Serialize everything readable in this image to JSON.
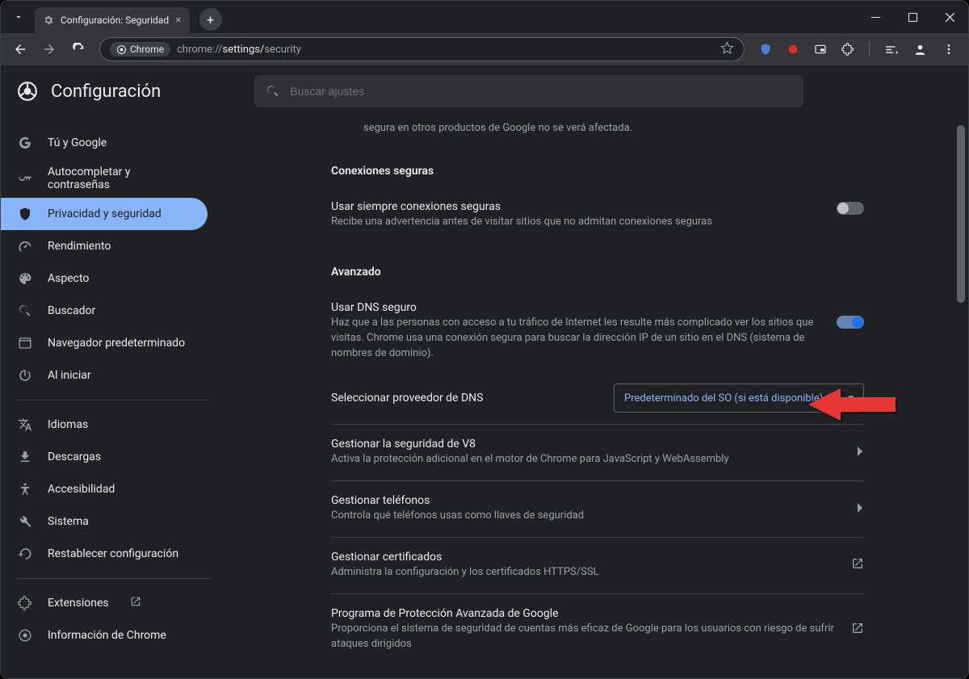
{
  "browser": {
    "tab_title": "Configuración: Seguridad",
    "omnibox_chip": "Chrome",
    "url_scheme": "chrome://",
    "url_path1": "settings/",
    "url_path2": "security"
  },
  "app": {
    "title": "Configuración",
    "search_placeholder": "Buscar ajustes"
  },
  "sidebar": {
    "items": [
      {
        "label": "Tú y Google"
      },
      {
        "label": "Autocompletar y contraseñas"
      },
      {
        "label": "Privacidad y seguridad"
      },
      {
        "label": "Rendimiento"
      },
      {
        "label": "Aspecto"
      },
      {
        "label": "Buscador"
      },
      {
        "label": "Navegador predeterminado"
      },
      {
        "label": "Al iniciar"
      }
    ],
    "items2": [
      {
        "label": "Idiomas"
      },
      {
        "label": "Descargas"
      },
      {
        "label": "Accesibilidad"
      },
      {
        "label": "Sistema"
      },
      {
        "label": "Restablecer configuración"
      }
    ],
    "items3": [
      {
        "label": "Extensiones"
      },
      {
        "label": "Información de Chrome"
      }
    ]
  },
  "panel": {
    "partial_top": "segura en otros productos de Google no se verá afectada.",
    "section_secure_title": "Conexiones seguras",
    "always_secure_label": "Usar siempre conexiones seguras",
    "always_secure_sub": "Recibe una advertencia antes de visitar sitios que no admitan conexiones seguras",
    "advanced_title": "Avanzado",
    "secure_dns_label": "Usar DNS seguro",
    "secure_dns_sub": "Haz que a las personas con acceso a tu tráfico de Internet les resulte más complicado ver los sitios que visitas. Chrome usa una conexión segura para buscar la dirección IP de un sitio en el DNS (sistema de nombres de dominio).",
    "dns_provider_label": "Seleccionar proveedor de DNS",
    "dns_provider_value": "Predeterminado del SO (si está disponible)",
    "v8_label": "Gestionar la seguridad de V8",
    "v8_sub": "Activa la protección adicional en el motor de Chrome para JavaScript y WebAssembly",
    "phones_label": "Gestionar teléfonos",
    "phones_sub": "Controla qué teléfonos usas como llaves de seguridad",
    "certs_label": "Gestionar certificados",
    "certs_sub": "Administra la configuración y los certificados HTTPS/SSL",
    "app_label": "Programa de Protección Avanzada de Google",
    "app_sub": "Proporciona el sistema de seguridad de cuentas más eficaz de Google para los usuarios con riesgo de sufrir ataques dirigidos"
  }
}
